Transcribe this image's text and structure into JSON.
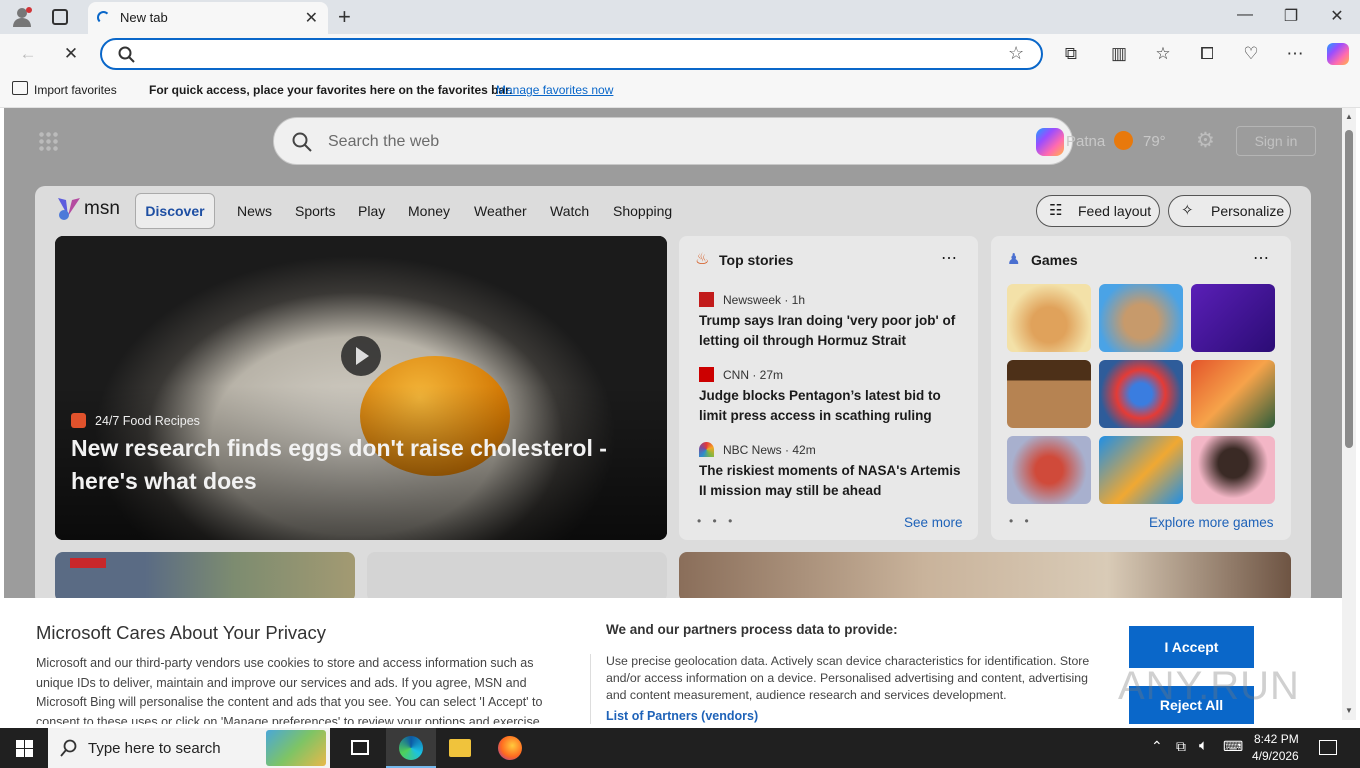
{
  "browser": {
    "tab_title": "New tab",
    "favorites_bar": {
      "import_label": "Import favorites",
      "message": "For quick access, place your favorites here on the favorites bar.",
      "manage_link": "Manage favorites now"
    }
  },
  "newtab": {
    "search_placeholder": "Search the web",
    "location": "Patna",
    "temperature": "79°",
    "sign_in": "Sign in"
  },
  "msn": {
    "logo": "msn",
    "nav": [
      "Discover",
      "News",
      "Sports",
      "Play",
      "Money",
      "Weather",
      "Watch",
      "Shopping"
    ],
    "feed_layout": "Feed layout",
    "personalize": "Personalize",
    "hero": {
      "source": "24/7 Food Recipes",
      "headline": "New research finds eggs don't raise cholesterol - here's what does"
    },
    "top_stories": {
      "title": "Top stories",
      "items": [
        {
          "source": "Newsweek · 1h",
          "headline": "Trump says Iran doing 'very poor job' of letting oil through Hormuz Strait"
        },
        {
          "source": "CNN · 27m",
          "headline": "Judge blocks Pentagon’s latest bid to limit press access in scathing ruling"
        },
        {
          "source": "NBC News · 42m",
          "headline": "The riskiest moments of NASA's Artemis II mission may still be ahead"
        }
      ],
      "see_more": "See more"
    },
    "games": {
      "title": "Games",
      "explore": "Explore more games"
    }
  },
  "privacy": {
    "title": "Microsoft Cares About Your Privacy",
    "body": "Microsoft and our third-party vendors use cookies to store and access information such as unique IDs to deliver, maintain and improve our services and ads. If you agree, MSN and Microsoft Bing will personalise the content and ads that you see. You can select 'I Accept' to consent to these uses or click on 'Manage preferences' to review your options and exercise",
    "process_title": "We and our partners process data to provide:",
    "process_body": "Use precise geolocation data. Actively scan device characteristics for identification. Store and/or access information on a device. Personalised advertising and content, advertising and content measurement, audience research and services development.",
    "partners_link": "List of Partners (vendors)",
    "accept": "I Accept",
    "reject": "Reject All"
  },
  "taskbar": {
    "search_placeholder": "Type here to search",
    "time": "8:42 PM",
    "date": "4/9/2026"
  },
  "watermark": "ANY.RUN"
}
